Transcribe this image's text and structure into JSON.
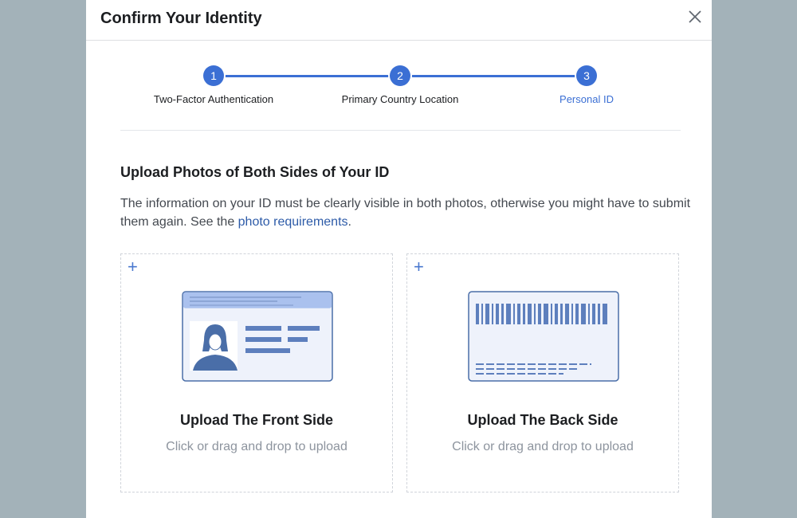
{
  "modal": {
    "title": "Confirm Your Identity",
    "close_icon": "close-icon"
  },
  "stepper": {
    "steps": [
      {
        "number": "1",
        "label": "Two-Factor Authentication",
        "active": false
      },
      {
        "number": "2",
        "label": "Primary Country Location",
        "active": false
      },
      {
        "number": "3",
        "label": "Personal ID",
        "active": true
      }
    ],
    "accent": "#3b6fd4"
  },
  "section": {
    "title": "Upload Photos of Both Sides of Your ID",
    "description_text": "The information on your ID must be clearly visible in both photos, otherwise you might have to submit them again. See the ",
    "link_text": "photo requirements",
    "description_end": "."
  },
  "uploads": [
    {
      "title": "Upload The Front Side",
      "subtitle": "Click or drag and drop to upload",
      "icon": "id-card-front-icon"
    },
    {
      "title": "Upload The Back Side",
      "subtitle": "Click or drag and drop to upload",
      "icon": "id-card-back-icon"
    }
  ],
  "colors": {
    "background": "#a3b2b9",
    "link": "#2d5ba8",
    "card_fill": "#eef2fb",
    "card_stroke": "#4a6ea8"
  }
}
